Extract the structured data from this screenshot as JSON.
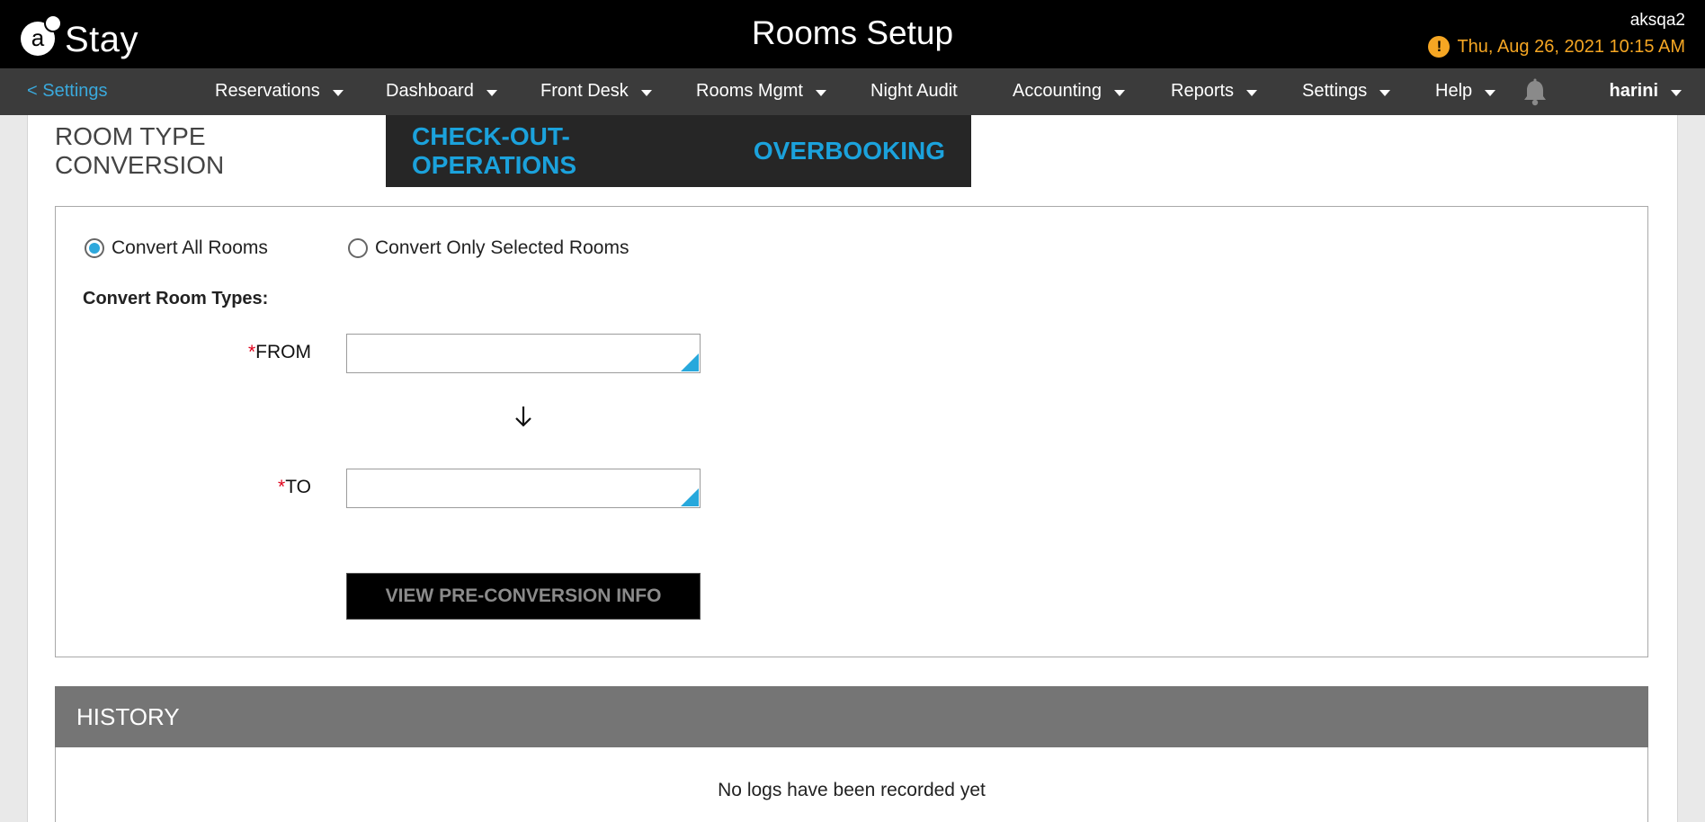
{
  "header": {
    "logo_text": "Stay",
    "page_title": "Rooms Setup",
    "property_code": "aksqa2",
    "datetime": "Thu, Aug 26, 2021 10:15 AM",
    "alert_icon": "exclamation-circle-icon",
    "alert_color": "#f5a623"
  },
  "nav": {
    "back_label": "< Settings",
    "items": [
      {
        "label": "Reservations",
        "has_menu": true
      },
      {
        "label": "Dashboard",
        "has_menu": true
      },
      {
        "label": "Front Desk",
        "has_menu": true
      },
      {
        "label": "Rooms Mgmt",
        "has_menu": true
      },
      {
        "label": "Night Audit",
        "has_menu": false
      },
      {
        "label": "Accounting",
        "has_menu": true
      },
      {
        "label": "Reports",
        "has_menu": true
      },
      {
        "label": "Settings",
        "has_menu": true
      },
      {
        "label": "Help",
        "has_menu": true
      }
    ],
    "notification_icon": "bell-icon",
    "user_name": "harini"
  },
  "tabs": [
    {
      "label": "ROOM TYPE CONVERSION",
      "active": true
    },
    {
      "label": "CHECK-OUT-OPERATIONS",
      "active": false
    },
    {
      "label": "OVERBOOKING",
      "active": false
    }
  ],
  "form": {
    "mode_options": [
      {
        "label": "Convert All Rooms",
        "selected": true
      },
      {
        "label": "Convert Only Selected Rooms",
        "selected": false
      }
    ],
    "section_label": "Convert Room Types:",
    "required_marker": "*",
    "from_label": "FROM",
    "from_value": "",
    "to_label": "TO",
    "to_value": "",
    "conversion_arrow_icon": "arrow-down-icon",
    "view_button_label": "VIEW PRE-CONVERSION INFO"
  },
  "history": {
    "title": "HISTORY",
    "empty_message": "No logs have been recorded yet"
  },
  "colors": {
    "accent": "#1ba2dc",
    "header_bg": "#000000",
    "nav_bg": "#3b3b3b",
    "required": "#e0001b"
  }
}
